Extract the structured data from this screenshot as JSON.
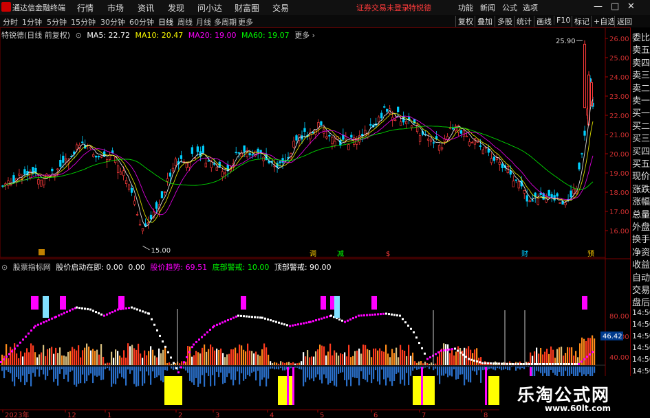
{
  "app": {
    "title": "通达信金融终端",
    "menu": [
      "行情",
      "市场",
      "资讯",
      "发现",
      "问小达",
      "财富圈",
      "交易"
    ],
    "login_status": "证券交易未登录",
    "stock_name_top": "特锐德",
    "right_menu": [
      "功能",
      "新闻",
      "公式",
      "选项"
    ],
    "window_controls": [
      "—",
      "□",
      "✕"
    ]
  },
  "toolbar": {
    "periods": [
      "分时",
      "1分钟",
      "5分钟",
      "15分钟",
      "30分钟",
      "60分钟",
      "日线",
      "周线",
      "月线",
      "多周期",
      "更多"
    ],
    "active_period": "日线",
    "right_buttons": [
      "复权",
      "叠加",
      "多股",
      "统计",
      "画线",
      "F10",
      "标记",
      "+自选",
      "返回"
    ]
  },
  "ma_legend": {
    "title": "特锐德(日线 前复权)",
    "ma5": "MA5: 22.72",
    "ma10": "MA10: 20.47",
    "ma20": "MA20: 19.00",
    "ma60": "MA60: 19.07",
    "colors": {
      "ma5": "#ffffff",
      "ma10": "#ffff00",
      "ma20": "#ff00ff",
      "ma60": "#00ff00"
    }
  },
  "price_axis": [
    "26.00",
    "25.00",
    "24.00",
    "23.00",
    "22.00",
    "21.00",
    "20.00",
    "19.00",
    "18.00",
    "17.00",
    "16.00"
  ],
  "price_annotations": {
    "high": "25.90",
    "low": "15.00"
  },
  "event_markers": [
    "调",
    "减",
    "$",
    "财",
    "预"
  ],
  "indicator": {
    "name": "股票指标网",
    "v1": "股价启动在即: 0.00",
    "v2": "0.00",
    "v3": "股价趋势: 69.51",
    "v4": "底部警戒: 10.00",
    "v5": "顶部警戒: 90.00",
    "axis": [
      "80.00",
      "60.00",
      "40.00"
    ],
    "current_value": "46.42",
    "colors": {
      "v1": "#ffffff",
      "v2": "#ffffff",
      "v3": "#ff00ff",
      "v4": "#00ff00",
      "v5": "#ffffff"
    }
  },
  "date_axis": [
    "2023年",
    "12",
    "1",
    "2",
    "3",
    "4",
    "5",
    "6",
    "7",
    "8"
  ],
  "right_panel": [
    "委比",
    "卖五",
    "卖四",
    "卖三",
    "卖二",
    "卖一",
    "买一",
    "买二",
    "买三",
    "买四",
    "买五",
    "现价",
    "涨跌",
    "涨幅",
    "总量",
    "外盘",
    "换手",
    "净资",
    "收益",
    "自动",
    "交易",
    "盘后",
    "14:50",
    "14:50",
    "14:50",
    "14:50",
    "14:50",
    "14:50",
    "14:50",
    "14:50"
  ],
  "watermark": {
    "title": "乐淘公式网",
    "url": "www.60lt.com"
  }
}
